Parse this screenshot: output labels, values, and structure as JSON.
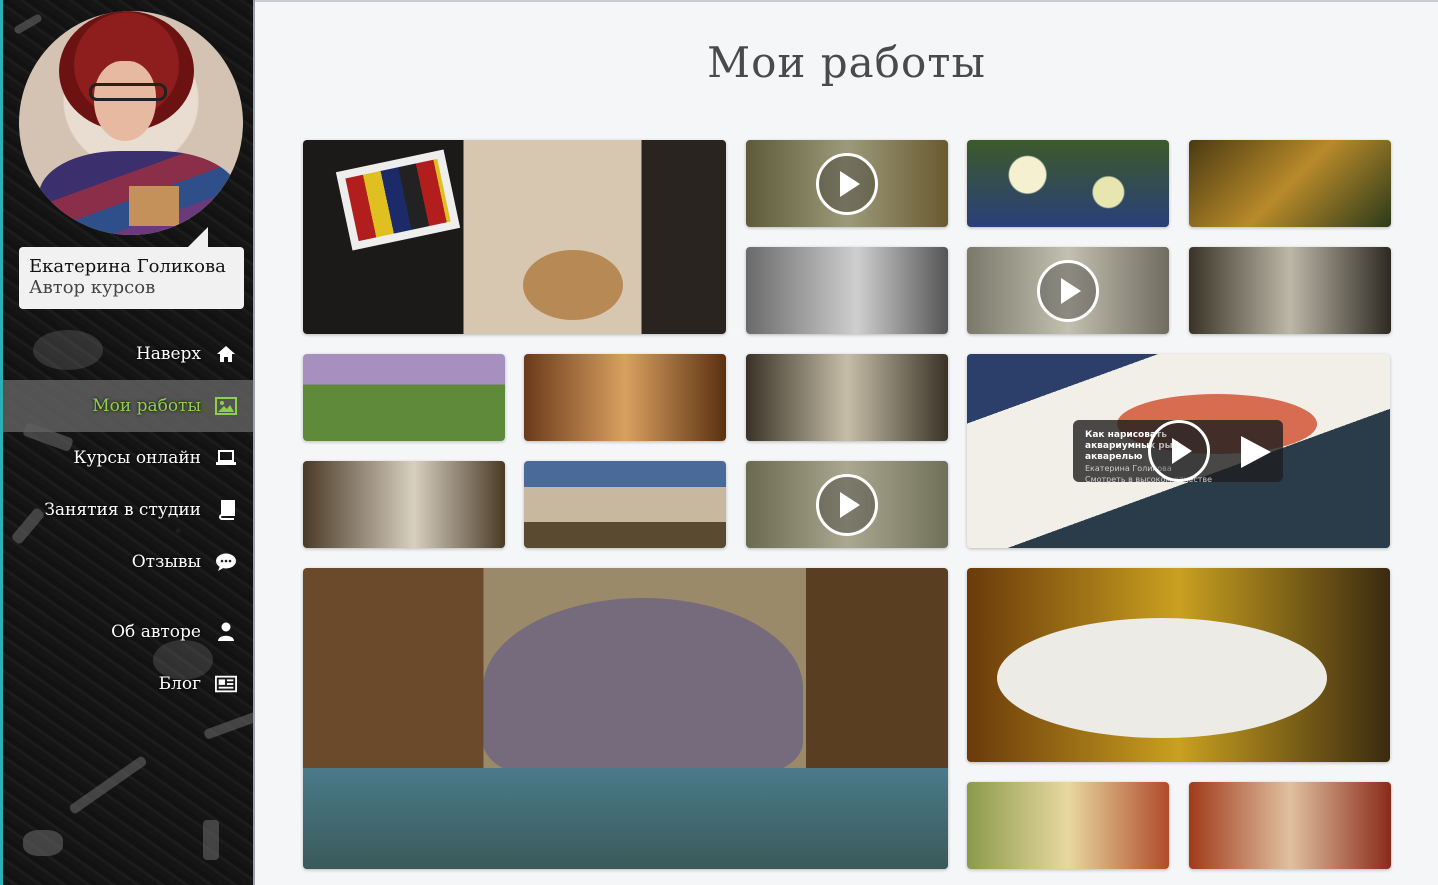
{
  "profile": {
    "name": "Екатерина Голикова",
    "role": "Автор курсов"
  },
  "nav": {
    "items": [
      {
        "label": "Наверх",
        "icon": "home-icon"
      },
      {
        "label": "Мои работы",
        "icon": "image-icon",
        "active": true
      },
      {
        "label": "Курсы онлайн",
        "icon": "laptop-icon"
      },
      {
        "label": "Занятия в студии",
        "icon": "book-icon"
      },
      {
        "label": "Отзывы",
        "icon": "comment-icon"
      },
      {
        "label": "Об авторе",
        "icon": "user-icon"
      },
      {
        "label": "Блог",
        "icon": "newspaper-icon"
      }
    ]
  },
  "main": {
    "title": "Мои работы",
    "video_overlay": {
      "title": "Как нарисовать аквариумных рыб акварелью",
      "author": "Екатерина Голикова",
      "quality_note": "Смотреть в высоком качестве"
    }
  },
  "colors": {
    "accent_active": "#8fd04a",
    "sidebar_bg": "#161616",
    "page_bg": "#f5f6f8",
    "title": "#4a4a4a"
  }
}
